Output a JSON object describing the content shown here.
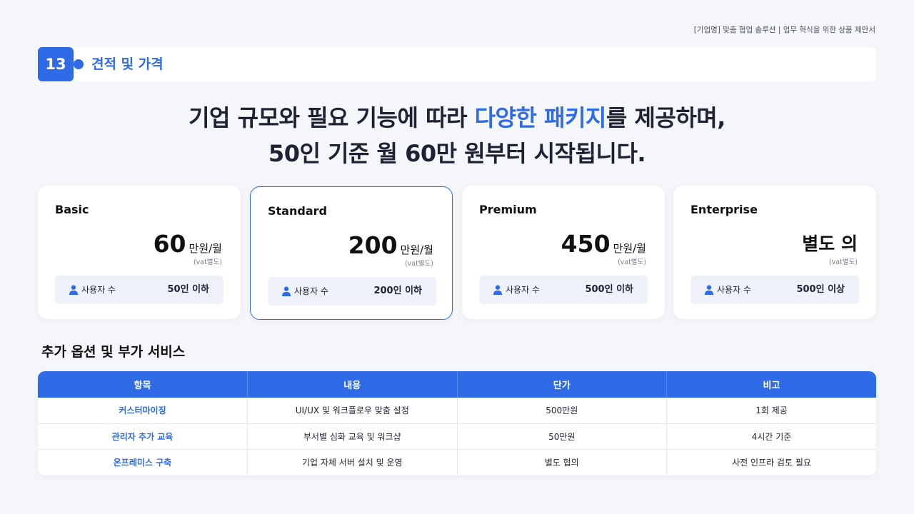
{
  "header": {
    "topline": "[기업명] 맞춤 협업 솔루션  |  업무 혁식을 위한 상품 제안서"
  },
  "section": {
    "number": "13",
    "title": "견적 및 가격"
  },
  "headline": {
    "line1_pre": "기업 규모와 필요 기능에 따라 ",
    "line1_highlight": "다양한 패키지",
    "line1_post": "를 제공하며,",
    "line2": "50인 기준 월 60만 원부터 시작됩니다."
  },
  "plans": [
    {
      "name": "Basic",
      "price": "60",
      "unit": "만원/월",
      "vat": "(vat별도)",
      "users_label": "사용자 수",
      "users_value": "50인 이하"
    },
    {
      "name": "Standard",
      "price": "200",
      "unit": "만원/월",
      "vat": "(vat별도)",
      "users_label": "사용자 수",
      "users_value": "200인 이하"
    },
    {
      "name": "Premium",
      "price": "450",
      "unit": "만원/월",
      "vat": "(vat별도)",
      "users_label": "사용자 수",
      "users_value": "500인 이하"
    },
    {
      "name": "Enterprise",
      "price_text": "별도 의",
      "vat": "(vat별도)",
      "users_label": "사용자 수",
      "users_value": "500인 이상"
    }
  ],
  "options": {
    "title": "추가 옵션 및 부가 서비스",
    "columns": [
      "항목",
      "내용",
      "단가",
      "비고"
    ],
    "rows": [
      [
        "커스터마이징",
        "UI/UX 및 워크플로우 맞춤 설정",
        "500만원",
        "1회 제공"
      ],
      [
        "관리자 추가 교육",
        "부서별 심화 교육 및 워크샵",
        "50만원",
        "4시간 기준"
      ],
      [
        "온프레미스 구축",
        "기업 자체 서버 설치 및 운영",
        "별도 협의",
        "사전 인프라 검토 필요"
      ]
    ]
  },
  "colors": {
    "accent": "#2f6be6",
    "background": "#f5f6f9"
  },
  "icons": {
    "users": "user-icon"
  }
}
